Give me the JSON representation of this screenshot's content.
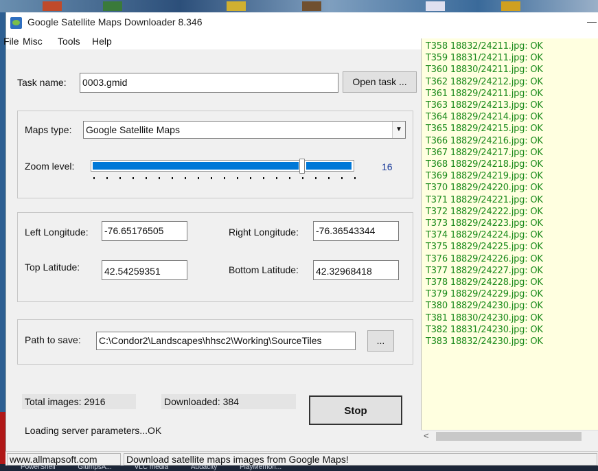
{
  "window": {
    "title": "Google Satellite Maps Downloader 8.346",
    "minimize_glyph": "—"
  },
  "menu": [
    "File",
    "Misc",
    "Tools",
    "Help"
  ],
  "task": {
    "label": "Task name:",
    "value": "0003.gmid",
    "open_button": "Open task ..."
  },
  "maps": {
    "type_label": "Maps type:",
    "type_value": "Google Satellite Maps",
    "zoom_label": "Zoom level:",
    "zoom_value": "16"
  },
  "coords": {
    "left_lon_label": "Left Longitude:",
    "left_lon": "-76.65176505",
    "right_lon_label": "Right Longitude:",
    "right_lon": "-76.36543344",
    "top_lat_label": "Top Latitude:",
    "top_lat": "42.54259351",
    "bottom_lat_label": "Bottom Latitude:",
    "bottom_lat": "42.32968418"
  },
  "path": {
    "label": "Path to save:",
    "value": "C:\\Condor2\\Landscapes\\hhsc2\\Working\\SourceTiles",
    "browse_button": "..."
  },
  "progress": {
    "total": "Total images: 2916",
    "downloaded": "Downloaded: 384",
    "stop_button": "Stop",
    "status": "Loading server parameters...OK"
  },
  "log": [
    "T358 18832/24211.jpg: OK",
    "T359 18831/24211.jpg: OK",
    "T360 18830/24211.jpg: OK",
    "T362 18829/24212.jpg: OK",
    "T361 18829/24211.jpg: OK",
    "T363 18829/24213.jpg: OK",
    "T364 18829/24214.jpg: OK",
    "T365 18829/24215.jpg: OK",
    "T366 18829/24216.jpg: OK",
    "T367 18829/24217.jpg: OK",
    "T368 18829/24218.jpg: OK",
    "T369 18829/24219.jpg: OK",
    "T370 18829/24220.jpg: OK",
    "T371 18829/24221.jpg: OK",
    "T372 18829/24222.jpg: OK",
    "T373 18829/24223.jpg: OK",
    "T374 18829/24224.jpg: OK",
    "T375 18829/24225.jpg: OK",
    "T376 18829/24226.jpg: OK",
    "T377 18829/24227.jpg: OK",
    "T378 18829/24228.jpg: OK",
    "T379 18829/24229.jpg: OK",
    "T380 18829/24230.jpg: OK",
    "T381 18830/24230.jpg: OK",
    "T382 18831/24230.jpg: OK",
    "T383 18832/24230.jpg: OK"
  ],
  "log_scroll_left": "<",
  "statusbar": {
    "site": "www.allmapsoft.com",
    "message": "Download satellite maps images from Google Maps!"
  },
  "taskbar": [
    "PowerShell",
    "GlumpsA...",
    "VLC media",
    "Audacity",
    "PlayMemori..."
  ],
  "colors": {
    "log_text": "#1a8a1a",
    "log_bg": "#ffffe0",
    "slider_fill": "#0078d7",
    "zoom_value_color": "#1a3a9a"
  }
}
